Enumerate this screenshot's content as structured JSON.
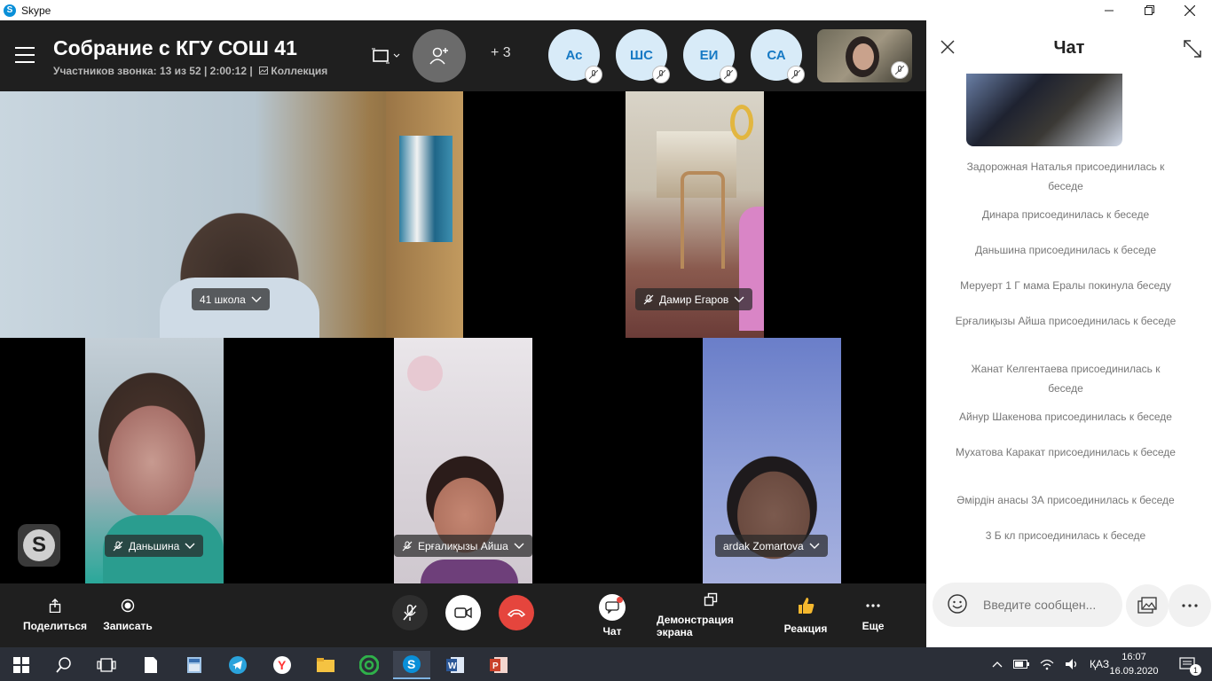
{
  "window": {
    "app_title": "Skype",
    "logo_letter": "S"
  },
  "call": {
    "title": "Собрание с КГУ СОШ 41",
    "subtitle": "Участников звонка: 13 из 52 | 2:00:12 |",
    "collection_label": "Коллекция",
    "extra_participants": "+ 3",
    "avatars": [
      {
        "initials": "Ас"
      },
      {
        "initials": "ШС"
      },
      {
        "initials": "ЕИ"
      },
      {
        "initials": "СА"
      }
    ]
  },
  "tiles": [
    {
      "name": "41 школа",
      "muted": false
    },
    {
      "name": "Дамир Егаров",
      "muted": true
    },
    {
      "name": "Даньшина",
      "muted": true
    },
    {
      "name": "Ерғалиқызы Айша",
      "muted": true
    },
    {
      "name": "ardak Zomartova",
      "muted": false
    }
  ],
  "floating_logo": "S",
  "controls": {
    "share": "Поделиться",
    "record": "Записать",
    "chat": "Чат",
    "screen_share": "Демонстрация экрана",
    "reaction": "Реакция",
    "more": "Еще"
  },
  "chat": {
    "title": "Чат",
    "messages": [
      "Задорожная Наталья присоединилась к беседе",
      "Динара присоединилась к беседе",
      "Даньшина присоединилась к беседе",
      "Меруерт 1 Г мама Ералы покинула беседу",
      "Ерғалиқызы Айша присоединилась к беседе",
      "Жанат Келгентаева присоединилась к беседе",
      "Айнур Шакенова присоединилась к беседе",
      "Мухатова Каракат присоединилась к беседе",
      "Әмірдін анасы 3А присоединилась к беседе",
      "3 Б кл присоединилась к беседе"
    ],
    "input_placeholder": "Введите сообщен..."
  },
  "taskbar": {
    "language": "ҚАЗ",
    "time": "16:07",
    "date": "16.09.2020",
    "notifications": "1"
  },
  "colors": {
    "skype_blue": "#0a8fd8",
    "hangup_red": "#e5453d",
    "header_bg": "#1f1f1f",
    "avatar_bg": "#d8ebf8",
    "avatar_text": "#1679c4"
  }
}
